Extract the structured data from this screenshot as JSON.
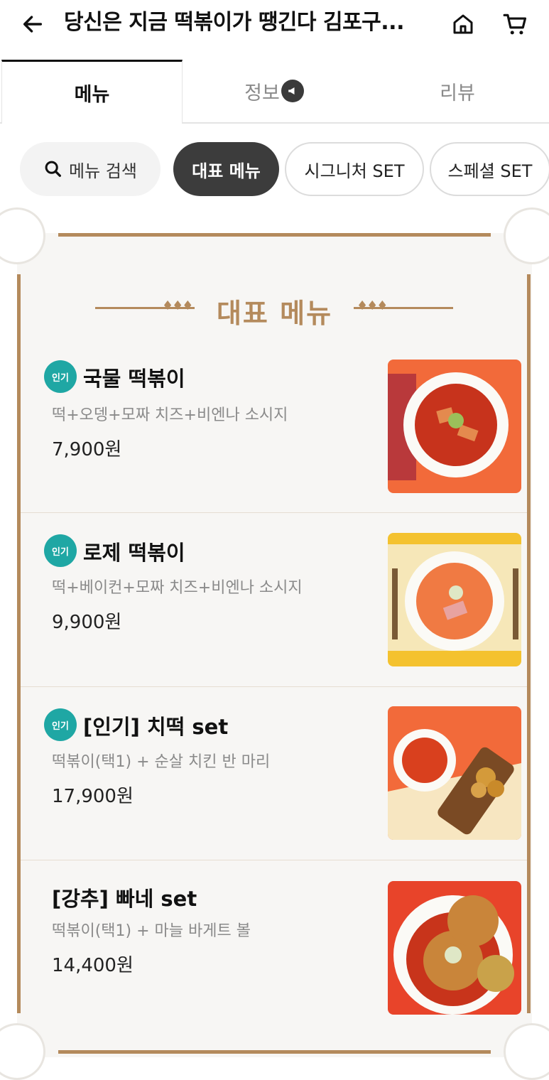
{
  "header": {
    "title": "당신은 지금 떡볶이가 땡긴다 김포구...",
    "icons": {
      "back": "arrow-left-icon",
      "home": "home-icon",
      "cart": "cart-icon"
    }
  },
  "tabs": [
    {
      "label": "메뉴",
      "active": true
    },
    {
      "label": "정보",
      "active": false
    },
    {
      "label": "리뷰",
      "active": false
    }
  ],
  "chips": {
    "search_label": "메뉴 검색",
    "items": [
      "대표 메뉴",
      "시그니처 SET",
      "스페셜 SET"
    ],
    "selected": "대표 메뉴"
  },
  "board": {
    "title": "대표 메뉴",
    "items": [
      {
        "badge": "인기",
        "name": "국물 떡볶이",
        "desc": "떡+오뎅+모짜 치즈+비엔나 소시지",
        "price": "7,900원"
      },
      {
        "badge": "인기",
        "name": "로제 떡볶이",
        "desc": "떡+베이컨+모짜 치즈+비엔나 소시지",
        "price": "9,900원"
      },
      {
        "badge": "인기",
        "name": "[인기] 치떡 set",
        "desc": "떡볶이(택1) + 순살 치킨 반 마리",
        "price": "17,900원"
      },
      {
        "badge": "",
        "name": "[강추] 빠네 set",
        "desc": "떡볶이(택1) + 마늘 바게트 볼",
        "price": "14,400원"
      }
    ]
  },
  "colors": {
    "accent": "#b48a5c",
    "badge": "#1fa7a4",
    "chip_selected": "#3c3c3c"
  }
}
